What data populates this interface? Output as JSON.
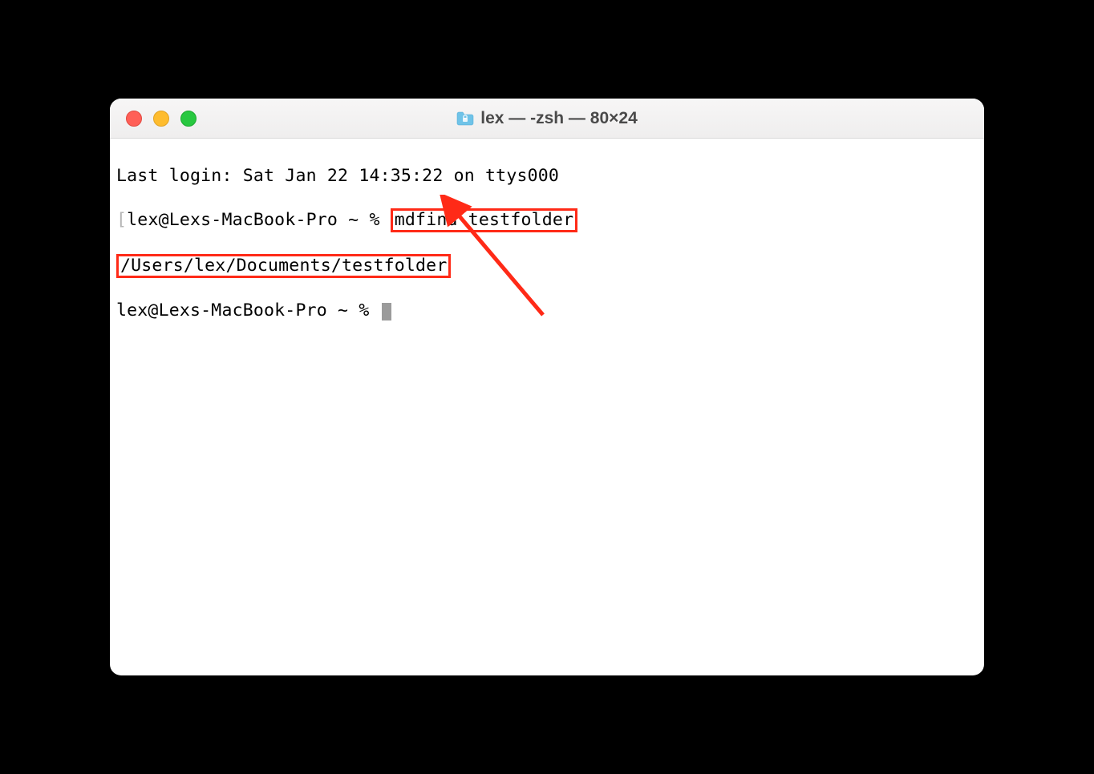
{
  "window": {
    "title": "lex — -zsh — 80×24"
  },
  "terminal": {
    "last_login": "Last login: Sat Jan 22 14:35:22 on ttys000",
    "prompt1_prefix": "lex@Lexs-MacBook-Pro ~ % ",
    "command1": "mdfind testfolder",
    "output1": "/Users/lex/Documents/testfolder",
    "prompt2": "lex@Lexs-MacBook-Pro ~ % "
  },
  "annotation": {
    "highlight_color": "#ff2a17"
  }
}
